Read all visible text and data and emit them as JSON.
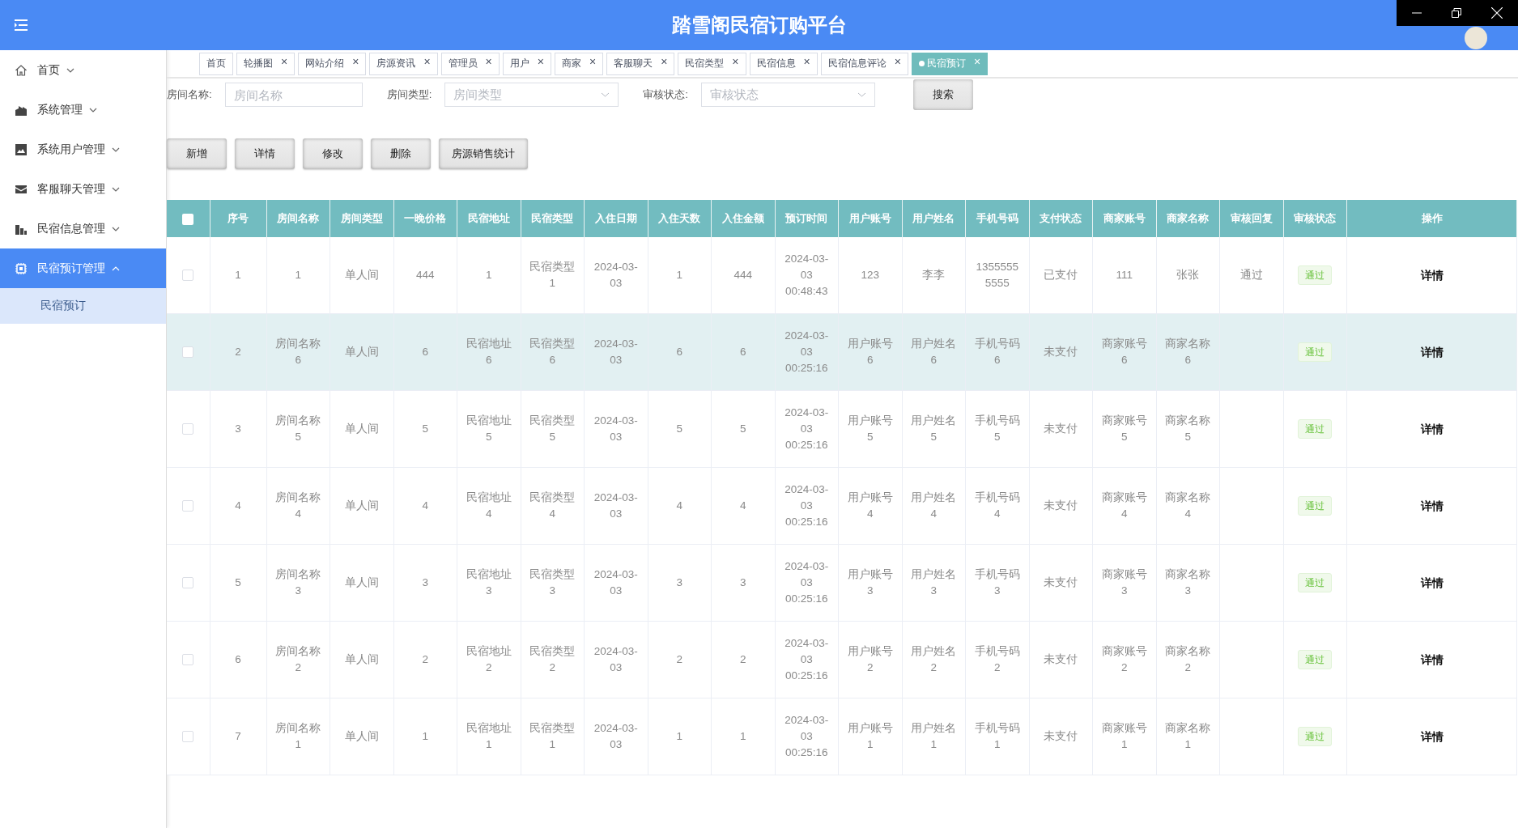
{
  "header": {
    "title": "踏雪阁民宿订购平台"
  },
  "sidebar": {
    "items": [
      {
        "label": "首页",
        "expanded": false,
        "selected": false
      },
      {
        "label": "系统管理",
        "expanded": false,
        "selected": false
      },
      {
        "label": "系统用户管理",
        "expanded": false,
        "selected": false
      },
      {
        "label": "客服聊天管理",
        "expanded": false,
        "selected": false
      },
      {
        "label": "民宿信息管理",
        "expanded": false,
        "selected": false
      },
      {
        "label": "民宿预订管理",
        "expanded": true,
        "selected": true,
        "children": [
          {
            "label": "民宿预订",
            "selected": true
          }
        ]
      }
    ]
  },
  "tabs": [
    {
      "label": "首页",
      "closable": false,
      "selected": false
    },
    {
      "label": "轮播图",
      "closable": true,
      "selected": false
    },
    {
      "label": "网站介绍",
      "closable": true,
      "selected": false
    },
    {
      "label": "房源资讯",
      "closable": true,
      "selected": false
    },
    {
      "label": "管理员",
      "closable": true,
      "selected": false
    },
    {
      "label": "用户",
      "closable": true,
      "selected": false
    },
    {
      "label": "商家",
      "closable": true,
      "selected": false
    },
    {
      "label": "客服聊天",
      "closable": true,
      "selected": false
    },
    {
      "label": "民宿类型",
      "closable": true,
      "selected": false
    },
    {
      "label": "民宿信息",
      "closable": true,
      "selected": false
    },
    {
      "label": "民宿信息评论",
      "closable": true,
      "selected": false
    },
    {
      "label": "民宿预订",
      "closable": true,
      "selected": true
    }
  ],
  "close_glyph": "×",
  "filters": [
    {
      "label": "房间名称:",
      "kind": "input",
      "placeholder": "房间名称"
    },
    {
      "label": "房间类型:",
      "kind": "select",
      "placeholder": "房间类型"
    },
    {
      "label": "审核状态:",
      "kind": "select",
      "placeholder": "审核状态"
    }
  ],
  "search_button": "搜索",
  "actions": [
    "新增",
    "详情",
    "修改",
    "删除",
    "房源销售统计"
  ],
  "table": {
    "all_selected": false,
    "columns": [
      "序号",
      "房间名称",
      "房间类型",
      "一晚价格",
      "民宿地址",
      "民宿类型",
      "入住日期",
      "入住天数",
      "入住金额",
      "预订时间",
      "用户账号",
      "用户姓名",
      "手机号码",
      "支付状态",
      "商家账号",
      "商家名称",
      "审核回复",
      "审核状态",
      "操作"
    ],
    "rows": [
      {
        "selected": false,
        "highlighted": false,
        "no": "1",
        "room_name": "1",
        "room_type": "单人间",
        "price": "444",
        "address": "1",
        "homestay_type": "民宿类型1",
        "checkin_date": "2024-03-03",
        "days": "1",
        "amount": "444",
        "booking_time": "2024-03-03 00:48:43",
        "user_account": "123",
        "user_name": "李李",
        "phone": "13555555555",
        "pay_status": "已支付",
        "merchant_account": "111",
        "merchant_name": "张张",
        "review_reply": "通过",
        "review_status": "通过",
        "action": "详情"
      },
      {
        "selected": false,
        "highlighted": true,
        "no": "2",
        "room_name": "房间名称6",
        "room_type": "单人间",
        "price": "6",
        "address": "民宿地址6",
        "homestay_type": "民宿类型6",
        "checkin_date": "2024-03-03",
        "days": "6",
        "amount": "6",
        "booking_time": "2024-03-03 00:25:16",
        "user_account": "用户账号6",
        "user_name": "用户姓名6",
        "phone": "手机号码6",
        "pay_status": "未支付",
        "merchant_account": "商家账号6",
        "merchant_name": "商家名称6",
        "review_status": "通过",
        "action": "详情"
      },
      {
        "selected": false,
        "highlighted": false,
        "no": "3",
        "room_name": "房间名称5",
        "room_type": "单人间",
        "price": "5",
        "address": "民宿地址5",
        "homestay_type": "民宿类型5",
        "checkin_date": "2024-03-03",
        "days": "5",
        "amount": "5",
        "booking_time": "2024-03-03 00:25:16",
        "user_account": "用户账号5",
        "user_name": "用户姓名5",
        "phone": "手机号码5",
        "pay_status": "未支付",
        "merchant_account": "商家账号5",
        "merchant_name": "商家名称5",
        "review_status": "通过",
        "action": "详情"
      },
      {
        "selected": false,
        "highlighted": false,
        "no": "4",
        "room_name": "房间名称4",
        "room_type": "单人间",
        "price": "4",
        "address": "民宿地址4",
        "homestay_type": "民宿类型4",
        "checkin_date": "2024-03-03",
        "days": "4",
        "amount": "4",
        "booking_time": "2024-03-03 00:25:16",
        "user_account": "用户账号4",
        "user_name": "用户姓名4",
        "phone": "手机号码4",
        "pay_status": "未支付",
        "merchant_account": "商家账号4",
        "merchant_name": "商家名称4",
        "review_status": "通过",
        "action": "详情"
      },
      {
        "selected": false,
        "highlighted": false,
        "no": "5",
        "room_name": "房间名称3",
        "room_type": "单人间",
        "price": "3",
        "address": "民宿地址3",
        "homestay_type": "民宿类型3",
        "checkin_date": "2024-03-03",
        "days": "3",
        "amount": "3",
        "booking_time": "2024-03-03 00:25:16",
        "user_account": "用户账号3",
        "user_name": "用户姓名3",
        "phone": "手机号码3",
        "pay_status": "未支付",
        "merchant_account": "商家账号3",
        "merchant_name": "商家名称3",
        "review_status": "通过",
        "action": "详情"
      },
      {
        "selected": false,
        "highlighted": false,
        "no": "6",
        "room_name": "房间名称2",
        "room_type": "单人间",
        "price": "2",
        "address": "民宿地址2",
        "homestay_type": "民宿类型2",
        "checkin_date": "2024-03-03",
        "days": "2",
        "amount": "2",
        "booking_time": "2024-03-03 00:25:16",
        "user_account": "用户账号2",
        "user_name": "用户姓名2",
        "phone": "手机号码2",
        "pay_status": "未支付",
        "merchant_account": "商家账号2",
        "merchant_name": "商家名称2",
        "review_status": "通过",
        "action": "详情"
      },
      {
        "selected": false,
        "highlighted": false,
        "no": "7",
        "room_name": "房间名称1",
        "room_type": "单人间",
        "price": "1",
        "address": "民宿地址1",
        "homestay_type": "民宿类型1",
        "checkin_date": "2024-03-03",
        "days": "1",
        "amount": "1",
        "booking_time": "2024-03-03 00:25:16",
        "user_account": "用户账号1",
        "user_name": "用户姓名1",
        "phone": "手机号码1",
        "pay_status": "未支付",
        "merchant_account": "商家账号1",
        "merchant_name": "商家名称1",
        "review_status": "通过",
        "action": "详情"
      }
    ]
  }
}
